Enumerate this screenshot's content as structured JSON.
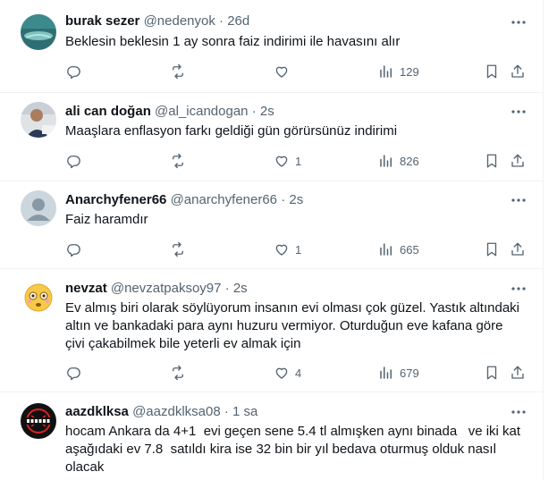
{
  "tweets": [
    {
      "name": "burak sezer",
      "handle": "@nedenyok",
      "separator": "·",
      "time": "26d",
      "text": [
        "Beklesin beklesin 1 ay sonra faiz indirimi ile havasını alır"
      ],
      "replies": "",
      "retweets": "",
      "likes": "",
      "views": "129"
    },
    {
      "name": "ali can doğan",
      "handle": "@al_icandogan",
      "separator": "·",
      "time": "2s",
      "text": [
        "Maaşlara enflasyon farkı geldiği gün görürsünüz indirimi"
      ],
      "replies": "",
      "retweets": "",
      "likes": "1",
      "views": "826"
    },
    {
      "name": "Anarchyfener66",
      "handle": "@anarchyfener66",
      "separator": "·",
      "time": "2s",
      "text": [
        "Faiz haramdır"
      ],
      "replies": "",
      "retweets": "",
      "likes": "1",
      "views": "665"
    },
    {
      "name": "nevzat",
      "handle": "@nevzatpaksoy97",
      "separator": "·",
      "time": "2s",
      "text": [
        "Ev almış biri olarak söylüyorum insanın evi olması çok güzel. Yastık altındaki",
        "altın ve bankadaki para aynı huzuru vermiyor. Oturduğun eve kafana göre",
        "çivi çakabilmek bile yeterli ev almak için"
      ],
      "replies": "",
      "retweets": "",
      "likes": "4",
      "views": "679"
    },
    {
      "name": "aazdklksa",
      "handle": "@aazdklksa08",
      "separator": "·",
      "time": "1 sa",
      "text": [
        "hocam Ankara da 4+1  evi geçen sene 5.4 tl almışken aynı binada   ve iki kat",
        "aşağıdaki ev 7.8  satıldı kira ise 32 bin bir yıl bedava oturmuş olduk nasıl",
        "olacak"
      ],
      "replies": "",
      "retweets": "",
      "likes": "",
      "views": ""
    }
  ],
  "icons": {
    "more": "more-dots-icon",
    "reply": "reply-bubble-icon",
    "retweet": "retweet-arrows-icon",
    "like": "heart-icon",
    "views": "bar-chart-icon",
    "bookmark": "bookmark-icon",
    "share": "share-upload-icon"
  },
  "colors": {
    "text": "#0f1419",
    "secondary": "#536471",
    "divider": "#eff3f4"
  }
}
